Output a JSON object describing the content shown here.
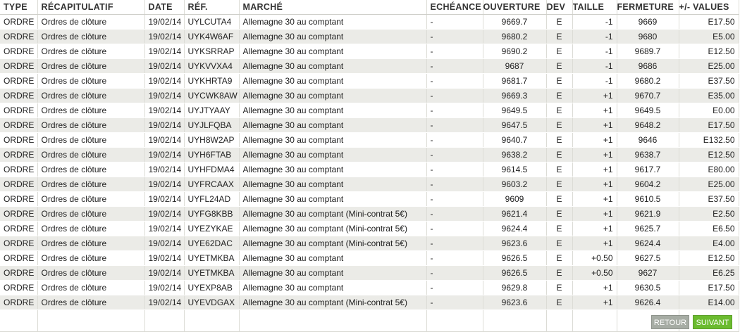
{
  "columns": {
    "type": "TYPE",
    "recap": "RÉCAPITULATIF",
    "date": "DATE",
    "ref": "RÉF.",
    "market": "MARCHÉ",
    "expiry": "ECHÉANCE",
    "open": "OUVERTURE",
    "currency": "DEV",
    "size": "TAILLE",
    "close": "FERMETURE",
    "pnl": "+/- VALUES"
  },
  "rows": [
    {
      "type": "ORDRE",
      "recap": "Ordres de clôture",
      "date": "19/02/14",
      "ref": "UYLCUTA4",
      "market": "Allemagne 30 au comptant",
      "expiry": "-",
      "open": "9669.7",
      "currency": "E",
      "size": "-1",
      "close": "9669",
      "pnl": "E17.50"
    },
    {
      "type": "ORDRE",
      "recap": "Ordres de clôture",
      "date": "19/02/14",
      "ref": "UYK4W6AF",
      "market": "Allemagne 30 au comptant",
      "expiry": "-",
      "open": "9680.2",
      "currency": "E",
      "size": "-1",
      "close": "9680",
      "pnl": "E5.00"
    },
    {
      "type": "ORDRE",
      "recap": "Ordres de clôture",
      "date": "19/02/14",
      "ref": "UYKSRRAP",
      "market": "Allemagne 30 au comptant",
      "expiry": "-",
      "open": "9690.2",
      "currency": "E",
      "size": "-1",
      "close": "9689.7",
      "pnl": "E12.50"
    },
    {
      "type": "ORDRE",
      "recap": "Ordres de clôture",
      "date": "19/02/14",
      "ref": "UYKVVXA4",
      "market": "Allemagne 30 au comptant",
      "expiry": "-",
      "open": "9687",
      "currency": "E",
      "size": "-1",
      "close": "9686",
      "pnl": "E25.00"
    },
    {
      "type": "ORDRE",
      "recap": "Ordres de clôture",
      "date": "19/02/14",
      "ref": "UYKHRTA9",
      "market": "Allemagne 30 au comptant",
      "expiry": "-",
      "open": "9681.7",
      "currency": "E",
      "size": "-1",
      "close": "9680.2",
      "pnl": "E37.50"
    },
    {
      "type": "ORDRE",
      "recap": "Ordres de clôture",
      "date": "19/02/14",
      "ref": "UYCWK8AW",
      "market": "Allemagne 30 au comptant",
      "expiry": "-",
      "open": "9669.3",
      "currency": "E",
      "size": "+1",
      "close": "9670.7",
      "pnl": "E35.00"
    },
    {
      "type": "ORDRE",
      "recap": "Ordres de clôture",
      "date": "19/02/14",
      "ref": "UYJTYAAY",
      "market": "Allemagne 30 au comptant",
      "expiry": "-",
      "open": "9649.5",
      "currency": "E",
      "size": "+1",
      "close": "9649.5",
      "pnl": "E0.00"
    },
    {
      "type": "ORDRE",
      "recap": "Ordres de clôture",
      "date": "19/02/14",
      "ref": "UYJLFQBA",
      "market": "Allemagne 30 au comptant",
      "expiry": "-",
      "open": "9647.5",
      "currency": "E",
      "size": "+1",
      "close": "9648.2",
      "pnl": "E17.50"
    },
    {
      "type": "ORDRE",
      "recap": "Ordres de clôture",
      "date": "19/02/14",
      "ref": "UYH8W2AP",
      "market": "Allemagne 30 au comptant",
      "expiry": "-",
      "open": "9640.7",
      "currency": "E",
      "size": "+1",
      "close": "9646",
      "pnl": "E132.50"
    },
    {
      "type": "ORDRE",
      "recap": "Ordres de clôture",
      "date": "19/02/14",
      "ref": "UYH6FTAB",
      "market": "Allemagne 30 au comptant",
      "expiry": "-",
      "open": "9638.2",
      "currency": "E",
      "size": "+1",
      "close": "9638.7",
      "pnl": "E12.50"
    },
    {
      "type": "ORDRE",
      "recap": "Ordres de clôture",
      "date": "19/02/14",
      "ref": "UYHFDMA4",
      "market": "Allemagne 30 au comptant",
      "expiry": "-",
      "open": "9614.5",
      "currency": "E",
      "size": "+1",
      "close": "9617.7",
      "pnl": "E80.00"
    },
    {
      "type": "ORDRE",
      "recap": "Ordres de clôture",
      "date": "19/02/14",
      "ref": "UYFRCAAX",
      "market": "Allemagne 30 au comptant",
      "expiry": "-",
      "open": "9603.2",
      "currency": "E",
      "size": "+1",
      "close": "9604.2",
      "pnl": "E25.00"
    },
    {
      "type": "ORDRE",
      "recap": "Ordres de clôture",
      "date": "19/02/14",
      "ref": "UYFL24AD",
      "market": "Allemagne 30 au comptant",
      "expiry": "-",
      "open": "9609",
      "currency": "E",
      "size": "+1",
      "close": "9610.5",
      "pnl": "E37.50"
    },
    {
      "type": "ORDRE",
      "recap": "Ordres de clôture",
      "date": "19/02/14",
      "ref": "UYFG8KBB",
      "market": "Allemagne 30 au comptant (Mini-contrat 5€)",
      "expiry": "-",
      "open": "9621.4",
      "currency": "E",
      "size": "+1",
      "close": "9621.9",
      "pnl": "E2.50"
    },
    {
      "type": "ORDRE",
      "recap": "Ordres de clôture",
      "date": "19/02/14",
      "ref": "UYEZYKAE",
      "market": "Allemagne 30 au comptant (Mini-contrat 5€)",
      "expiry": "-",
      "open": "9624.4",
      "currency": "E",
      "size": "+1",
      "close": "9625.7",
      "pnl": "E6.50"
    },
    {
      "type": "ORDRE",
      "recap": "Ordres de clôture",
      "date": "19/02/14",
      "ref": "UYE62DAC",
      "market": "Allemagne 30 au comptant (Mini-contrat 5€)",
      "expiry": "-",
      "open": "9623.6",
      "currency": "E",
      "size": "+1",
      "close": "9624.4",
      "pnl": "E4.00"
    },
    {
      "type": "ORDRE",
      "recap": "Ordres de clôture",
      "date": "19/02/14",
      "ref": "UYETMKBA",
      "market": "Allemagne 30 au comptant",
      "expiry": "-",
      "open": "9626.5",
      "currency": "E",
      "size": "+0.50",
      "close": "9627.5",
      "pnl": "E12.50"
    },
    {
      "type": "ORDRE",
      "recap": "Ordres de clôture",
      "date": "19/02/14",
      "ref": "UYETMKBA",
      "market": "Allemagne 30 au comptant",
      "expiry": "-",
      "open": "9626.5",
      "currency": "E",
      "size": "+0.50",
      "close": "9627",
      "pnl": "E6.25"
    },
    {
      "type": "ORDRE",
      "recap": "Ordres de clôture",
      "date": "19/02/14",
      "ref": "UYEXP8AB",
      "market": "Allemagne 30 au comptant",
      "expiry": "-",
      "open": "9629.8",
      "currency": "E",
      "size": "+1",
      "close": "9630.5",
      "pnl": "E17.50"
    },
    {
      "type": "ORDRE",
      "recap": "Ordres de clôture",
      "date": "19/02/14",
      "ref": "UYEVDGAX",
      "market": "Allemagne 30 au comptant (Mini-contrat 5€)",
      "expiry": "-",
      "open": "9623.6",
      "currency": "E",
      "size": "+1",
      "close": "9626.4",
      "pnl": "E14.00"
    }
  ],
  "buttons": {
    "back": "RETOUR",
    "next": "SUIVANT"
  },
  "colors": {
    "row_alt": "#ebebe7",
    "back_button": "#a6aca4",
    "next_button": "#6bbb2f"
  }
}
